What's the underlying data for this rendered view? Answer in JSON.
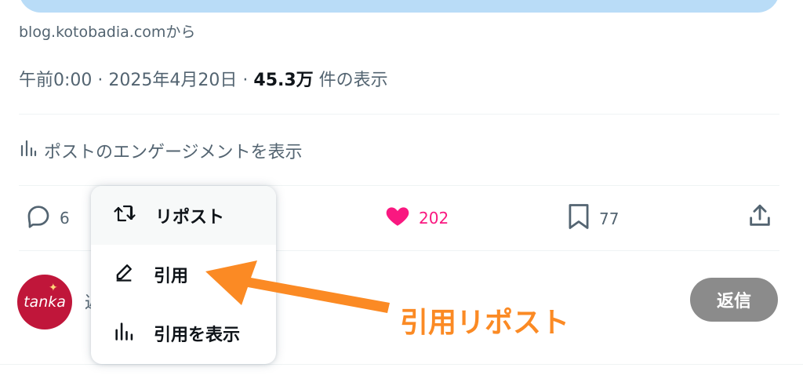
{
  "link_source": "blog.kotobadia.comから",
  "meta": {
    "time": "午前0:00",
    "separator": "·",
    "date": "2025年4月20日",
    "views_count": "45.3万",
    "views_label": "件の表示"
  },
  "engagement_link": "ポストのエンゲージメントを表示",
  "actions": {
    "reply_count": "6",
    "like_count": "202",
    "bookmark_count": "77"
  },
  "colors": {
    "like": "#f91880",
    "annotation": "#fb8a24",
    "card_preview": "#b9dcf7",
    "avatar": "#c0163a"
  },
  "reply_box": {
    "avatar_text": "tanka",
    "placeholder_fragment": "返",
    "reply_button": "返信"
  },
  "repost_menu": {
    "items": [
      {
        "label": "リポスト",
        "icon": "repost-icon"
      },
      {
        "label": "引用",
        "icon": "pencil-icon"
      },
      {
        "label": "引用を表示",
        "icon": "chart-icon"
      }
    ]
  },
  "annotation": {
    "label": "引用リポスト"
  }
}
